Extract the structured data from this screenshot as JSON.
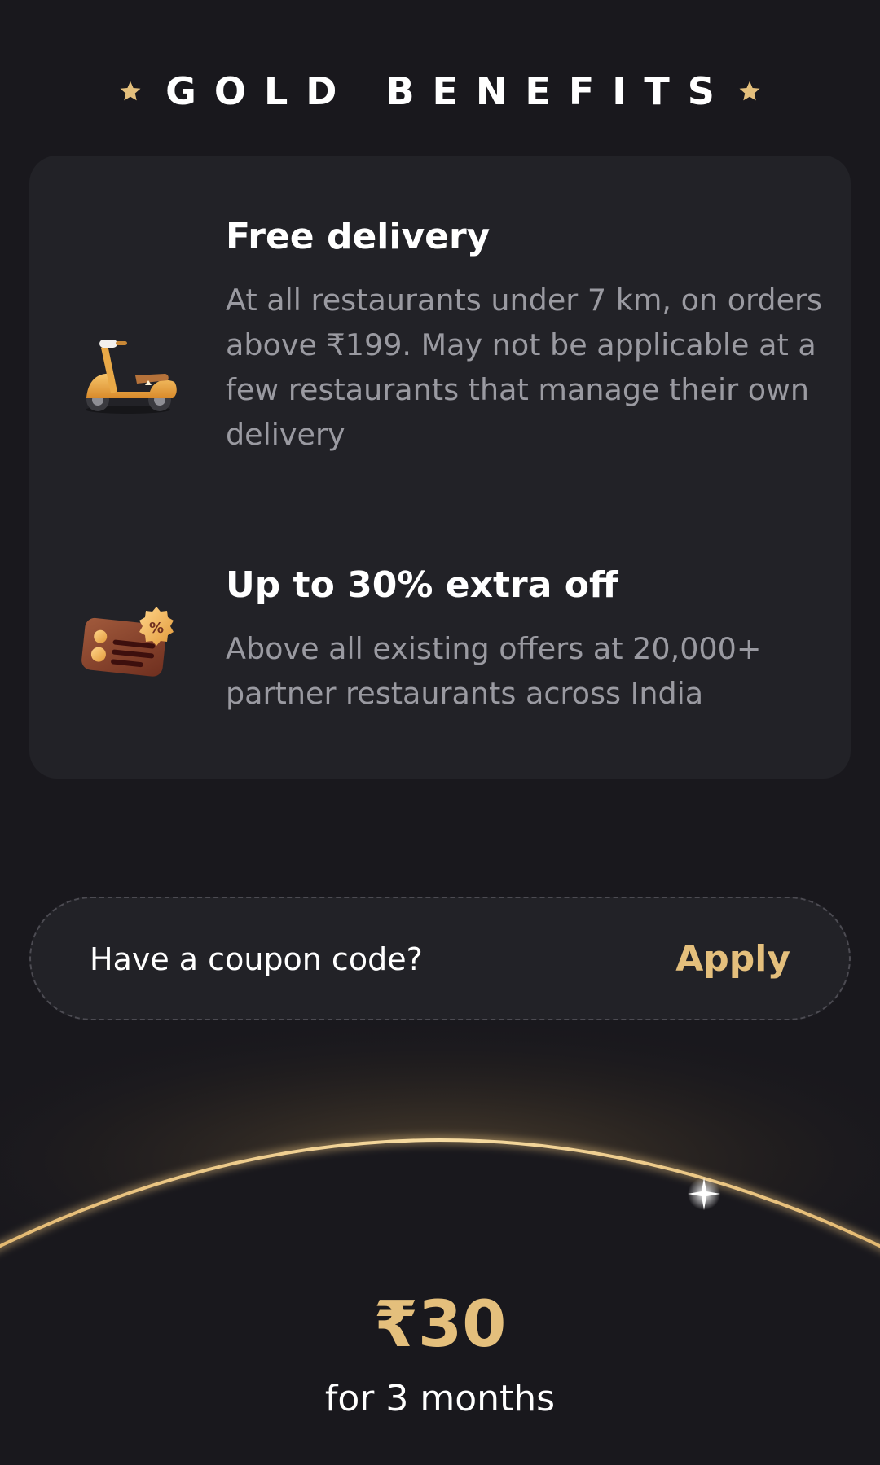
{
  "header": {
    "title": "GOLD BENEFITS",
    "left_icon": "star-icon",
    "right_icon": "star-icon"
  },
  "benefits": [
    {
      "icon": "scooter-icon",
      "title": "Free delivery",
      "description": "At all restaurants under 7 km, on orders above ₹199. May not be applicable at a few restaurants that manage their own delivery"
    },
    {
      "icon": "discount-card-icon",
      "title": "Up to 30% extra off",
      "description": "Above all existing offers at 20,000+ partner restaurants across India"
    }
  ],
  "coupon": {
    "prompt": "Have a coupon code?",
    "action_label": "Apply"
  },
  "plan": {
    "price": "₹30",
    "period": "for 3 months"
  },
  "colors": {
    "background": "#19181d",
    "card": "#222227",
    "gold": "#e4bf7c",
    "muted_text": "#9a9aa1",
    "primary_text": "#ffffff"
  }
}
